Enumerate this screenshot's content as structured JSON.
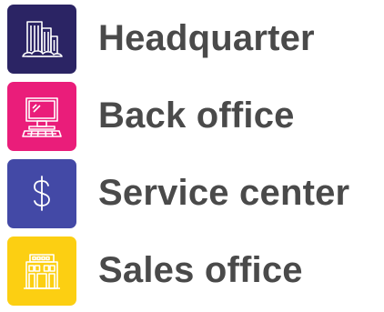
{
  "items": [
    {
      "label": "Headquarter",
      "icon": "office-towers-icon",
      "color": "#2b2464"
    },
    {
      "label": "Back office",
      "icon": "desktop-computer-icon",
      "color": "#ea1d7a"
    },
    {
      "label": "Service center",
      "icon": "dollar-sign-icon",
      "color": "#4349a6"
    },
    {
      "label": "Sales office",
      "icon": "shop-building-icon",
      "color": "#fccf12"
    }
  ]
}
